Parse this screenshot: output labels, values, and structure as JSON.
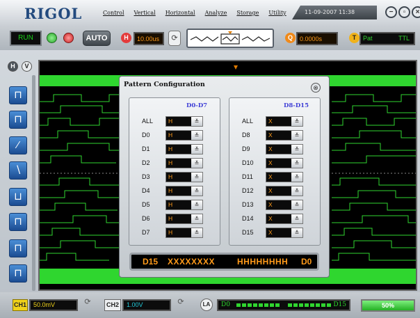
{
  "app": {
    "logo": "RIGOL",
    "datetime": "11-09-2007 11:38"
  },
  "menu": [
    "Control",
    "Vertical",
    "Horizontal",
    "Analyze",
    "Storage",
    "Utility"
  ],
  "toolbar": {
    "run_label": "RUN",
    "auto_label": "AUTO",
    "h_badge": "H",
    "timebase": "10.00us",
    "q_badge": "Q",
    "delay": "0.0000s",
    "t_badge": "T",
    "trigger_type": "Pat",
    "trigger_level": "TTL"
  },
  "side": {
    "h_label": "H",
    "v_label": "V"
  },
  "dialog": {
    "title": "Pattern Configuration",
    "close": "⊗",
    "left_panel": {
      "heading": "D0-D7",
      "rows": [
        {
          "label": "ALL",
          "value": "H"
        },
        {
          "label": "D0",
          "value": "H"
        },
        {
          "label": "D1",
          "value": "H"
        },
        {
          "label": "D2",
          "value": "H"
        },
        {
          "label": "D3",
          "value": "H"
        },
        {
          "label": "D4",
          "value": "H"
        },
        {
          "label": "D5",
          "value": "H"
        },
        {
          "label": "D6",
          "value": "H"
        },
        {
          "label": "D7",
          "value": "H"
        }
      ]
    },
    "right_panel": {
      "heading": "D8-D15",
      "rows": [
        {
          "label": "ALL",
          "value": "X"
        },
        {
          "label": "D8",
          "value": "X"
        },
        {
          "label": "D9",
          "value": "X"
        },
        {
          "label": "D10",
          "value": "X"
        },
        {
          "label": "D11",
          "value": "X"
        },
        {
          "label": "D12",
          "value": "X"
        },
        {
          "label": "D13",
          "value": "X"
        },
        {
          "label": "D14",
          "value": "X"
        },
        {
          "label": "D15",
          "value": "X"
        }
      ]
    },
    "summary": {
      "start": "D15",
      "high_byte": "XXXXXXXX",
      "low_byte": "HHHHHHHH",
      "end": "D0"
    }
  },
  "bottom": {
    "ch1_label": "CH1",
    "ch1_scale": "50.0mV",
    "ch2_label": "CH2",
    "ch2_scale": "1.00V",
    "la_label": "LA",
    "la_start": "D0",
    "la_end": "D15",
    "percent": "50%"
  },
  "colors": {
    "trace": "#2fd62f",
    "readout": "#ff9a1a",
    "accent_blue": "#3f3fd6"
  }
}
